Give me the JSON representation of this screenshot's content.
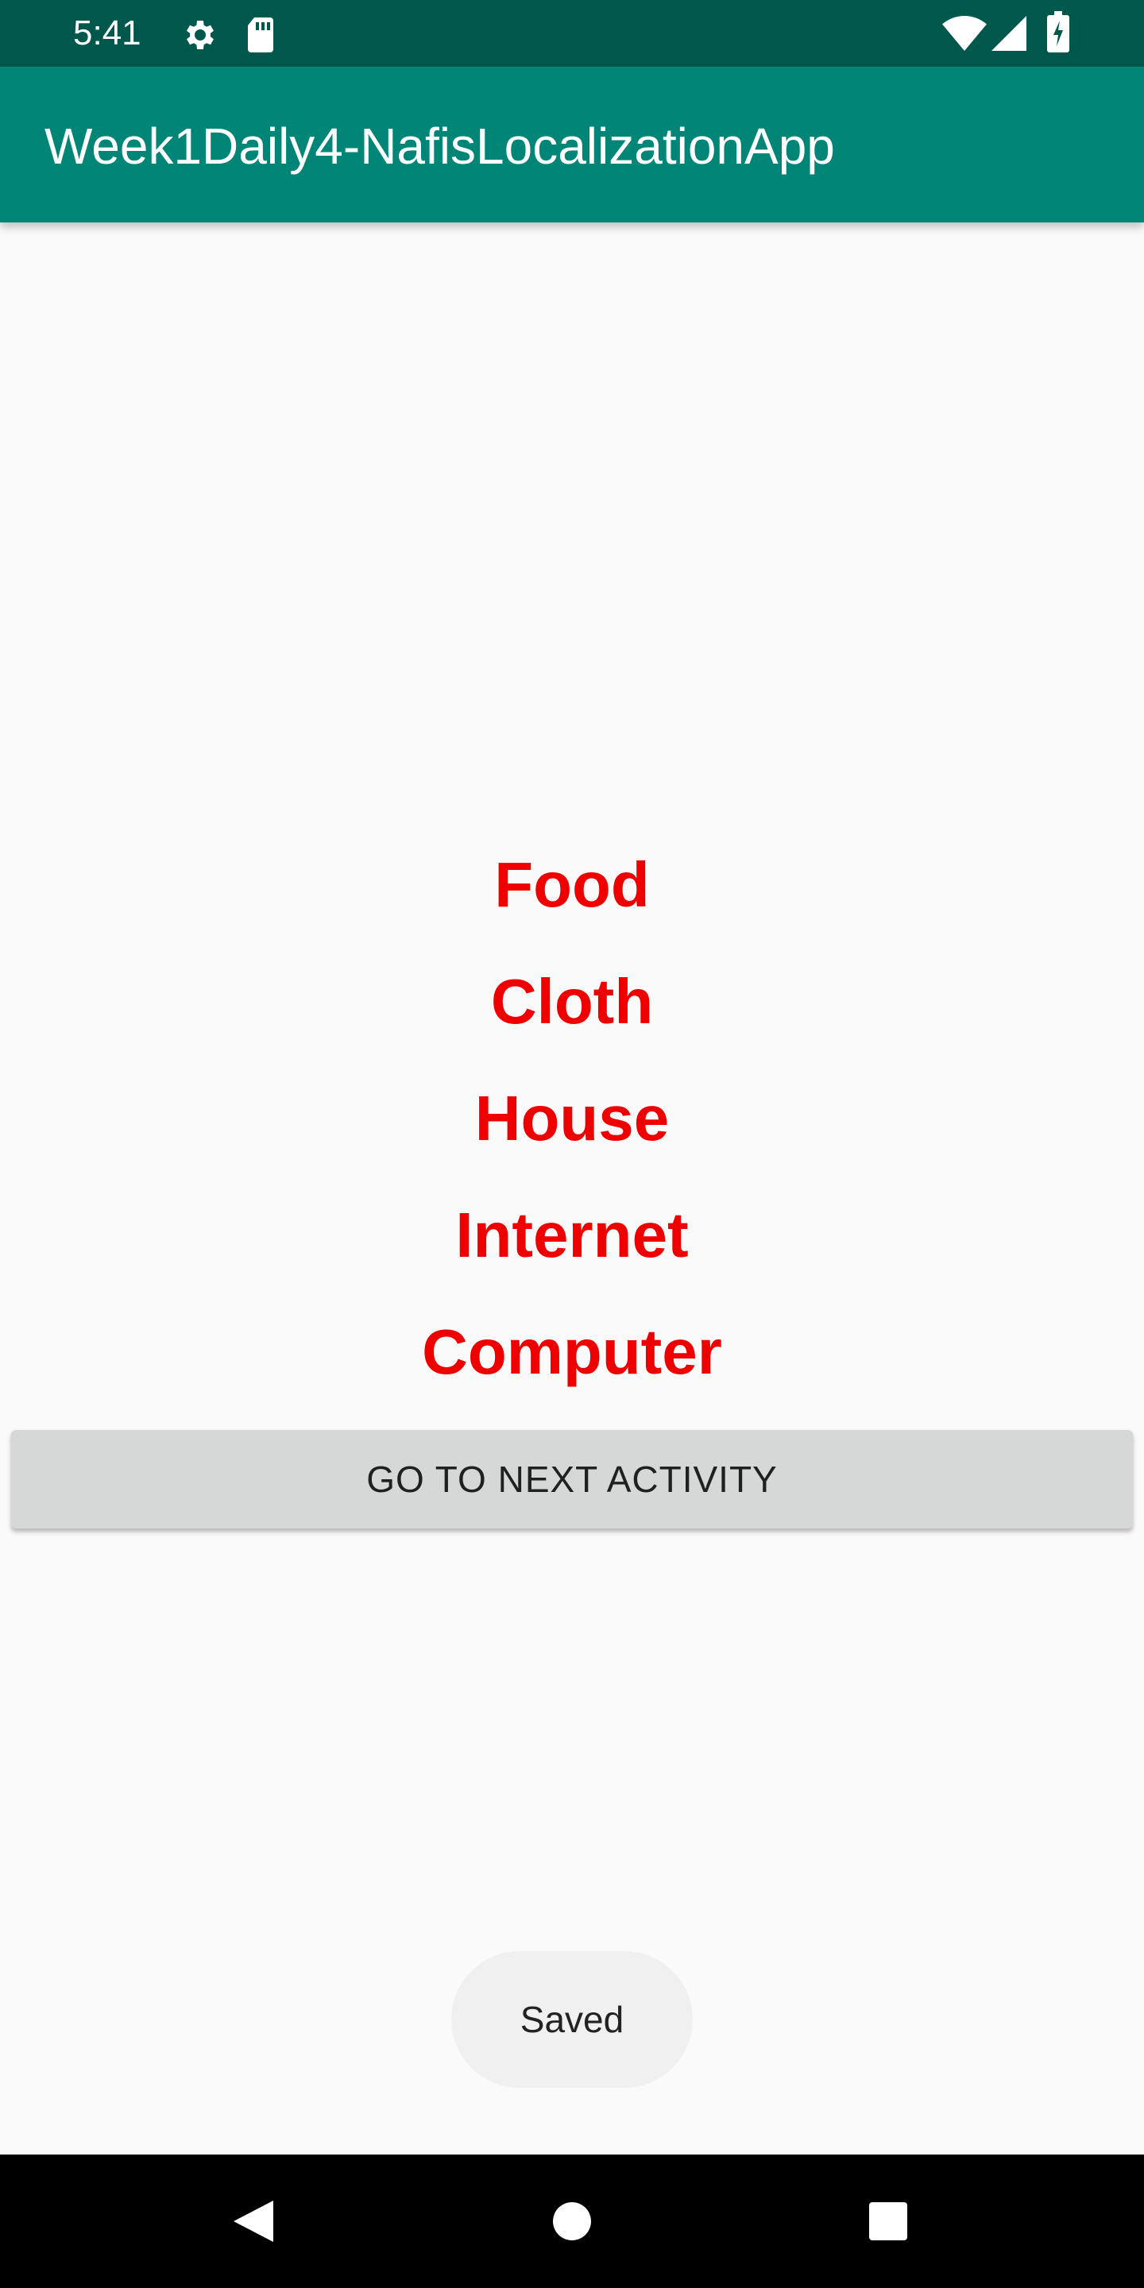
{
  "status_bar": {
    "time": "5:41",
    "icons": [
      "gear-icon",
      "sd-card-icon",
      "wifi-icon",
      "cell-signal-icon",
      "battery-charging-icon"
    ]
  },
  "app_bar": {
    "title": "Week1Daily4-NafisLocalizationApp"
  },
  "main": {
    "words": [
      "Food",
      "Cloth",
      "House",
      "Internet",
      "Computer"
    ],
    "word_color": "#ee0000",
    "next_button_label": "GO TO NEXT ACTIVITY"
  },
  "toast": {
    "message": "Saved"
  },
  "nav_bar": {
    "buttons": [
      "back-icon",
      "home-icon",
      "recents-icon"
    ]
  },
  "colors": {
    "status_bar": "#00574b",
    "app_bar": "#008577",
    "background": "#fafafa",
    "button": "#d6d7d7"
  }
}
